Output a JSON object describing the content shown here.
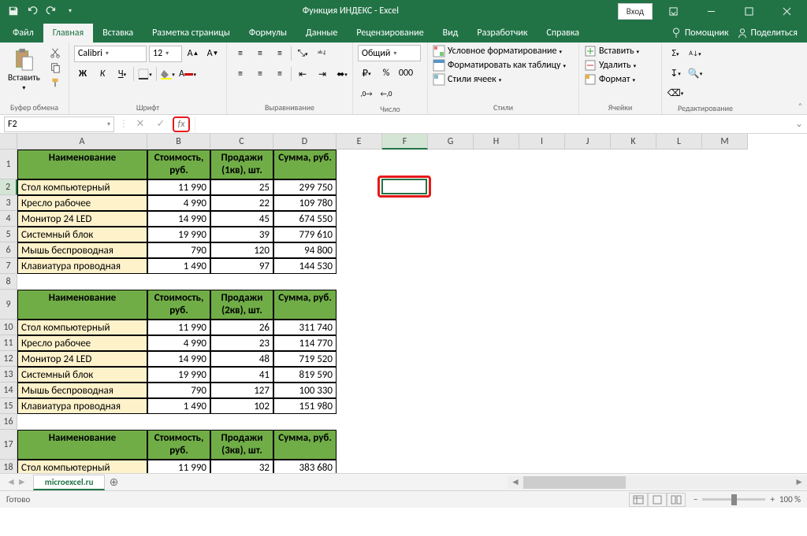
{
  "titlebar": {
    "title": "Функция ИНДЕКС  -  Excel",
    "login": "Вход"
  },
  "tabs": {
    "items": [
      "Файл",
      "Главная",
      "Вставка",
      "Разметка страницы",
      "Формулы",
      "Данные",
      "Рецензирование",
      "Вид",
      "Разработчик",
      "Справка"
    ],
    "active": 1,
    "help": "Помощник",
    "share": "Поделиться"
  },
  "ribbon": {
    "clipboard": {
      "paste": "Вставить",
      "label": "Буфер обмена"
    },
    "font": {
      "name": "Calibri",
      "size": "12",
      "label": "Шрифт"
    },
    "alignment": {
      "label": "Выравнивание"
    },
    "number": {
      "format": "Общий",
      "label": "Число"
    },
    "styles": {
      "cond": "Условное форматирование",
      "table": "Форматировать как таблицу",
      "cell": "Стили ячеек",
      "label": "Стили"
    },
    "cells": {
      "insert": "Вставить",
      "delete": "Удалить",
      "format": "Формат",
      "label": "Ячейки"
    },
    "editing": {
      "label": "Редактирование"
    }
  },
  "formula_bar": {
    "reference": "F2",
    "value": ""
  },
  "columns": {
    "letters": [
      "A",
      "B",
      "C",
      "D",
      "E",
      "F",
      "G",
      "H",
      "I",
      "J",
      "K",
      "L",
      "M"
    ],
    "widths": [
      165,
      80,
      80,
      80,
      58,
      58,
      58,
      58,
      58,
      58,
      58,
      58,
      58
    ]
  },
  "row_heights": {
    "normal": 20,
    "tall": 38
  },
  "headers": {
    "h1": [
      "Наименование",
      "Стоимость, руб.",
      "Продажи (1кв), шт.",
      "Сумма, руб."
    ],
    "h2": [
      "Наименование",
      "Стоимость, руб.",
      "Продажи (2кв), шт.",
      "Сумма, руб."
    ],
    "h3": [
      "Наименование",
      "Стоимость, руб.",
      "Продажи (3кв), шт.",
      "Сумма, руб."
    ]
  },
  "tables": {
    "t1": [
      [
        "Стол компьютерный",
        "11 990",
        "25",
        "299 750"
      ],
      [
        "Кресло рабочее",
        "4 990",
        "22",
        "109 780"
      ],
      [
        "Монитор 24 LED",
        "14 990",
        "45",
        "674 550"
      ],
      [
        "Системный блок",
        "19 990",
        "39",
        "779 610"
      ],
      [
        "Мышь беспроводная",
        "790",
        "120",
        "94 800"
      ],
      [
        "Клавиатура проводная",
        "1 490",
        "97",
        "144 530"
      ]
    ],
    "t2": [
      [
        "Стол компьютерный",
        "11 990",
        "26",
        "311 740"
      ],
      [
        "Кресло рабочее",
        "4 990",
        "23",
        "114 770"
      ],
      [
        "Монитор 24 LED",
        "14 990",
        "48",
        "719 520"
      ],
      [
        "Системный блок",
        "19 990",
        "41",
        "819 590"
      ],
      [
        "Мышь беспроводная",
        "790",
        "127",
        "100 330"
      ],
      [
        "Клавиатура проводная",
        "1 490",
        "102",
        "151 980"
      ]
    ],
    "t3": [
      [
        "Стол компьютерный",
        "11 990",
        "32",
        "383 680"
      ]
    ]
  },
  "sheet_tabs": {
    "active": "microexcel.ru"
  },
  "status": {
    "ready": "Готово",
    "zoom_minus": "−",
    "zoom_plus": "+",
    "zoom": "100 %"
  }
}
